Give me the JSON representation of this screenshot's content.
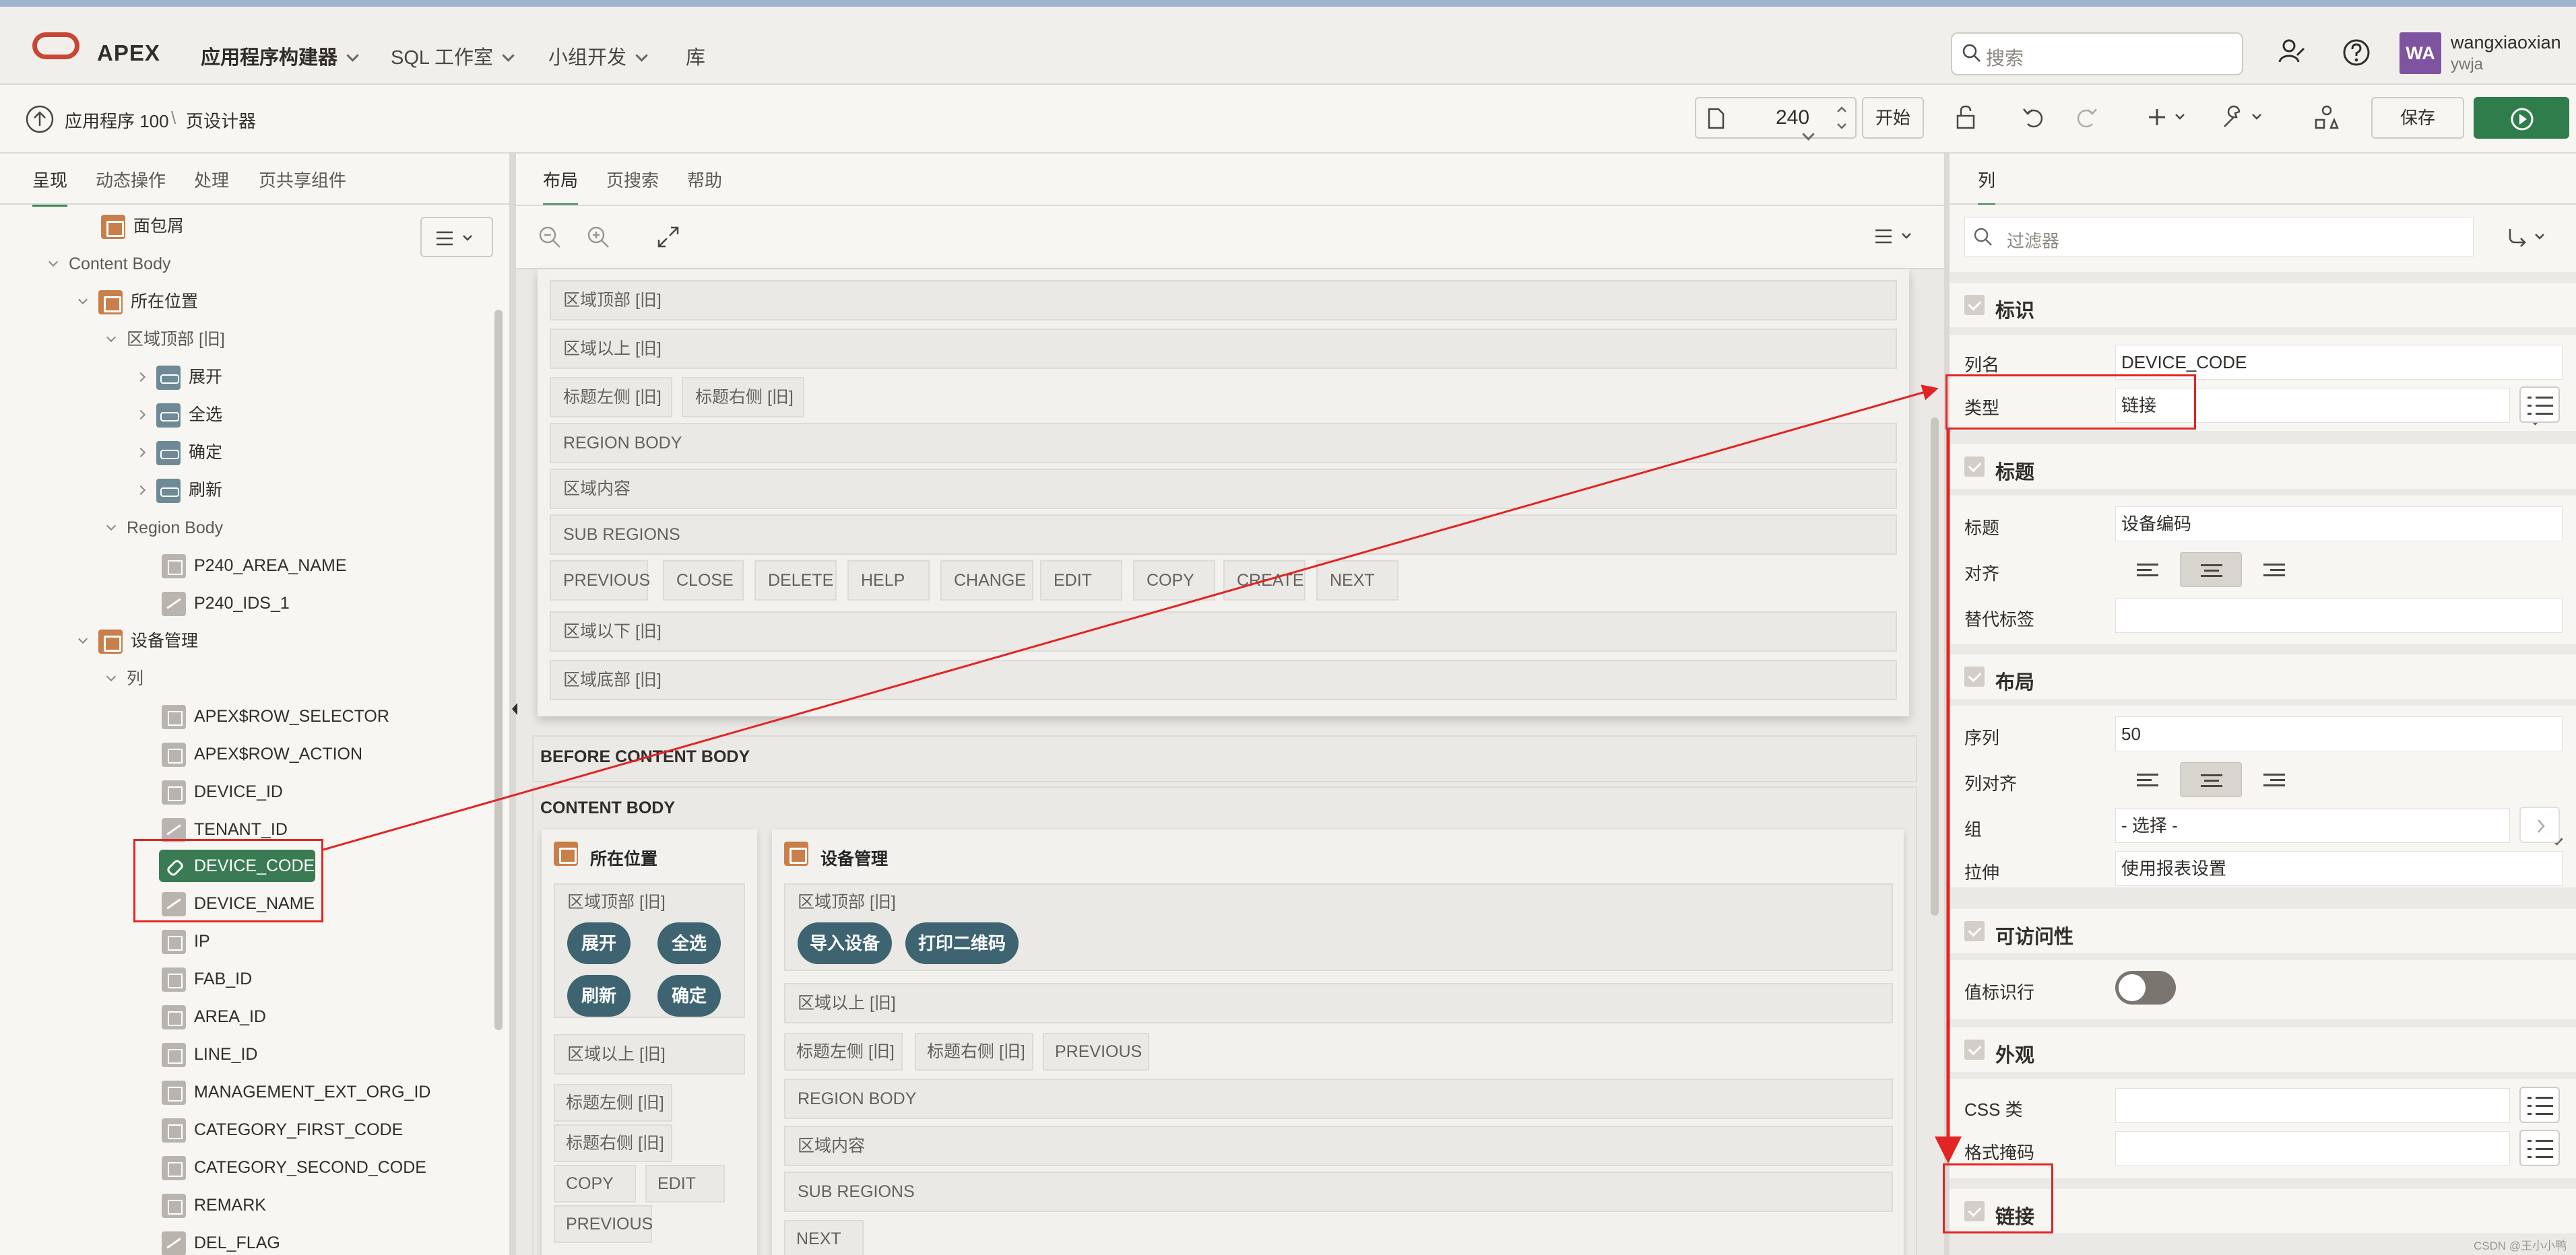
{
  "header": {
    "brand": "APEX",
    "nav": [
      "应用程序构建器",
      "SQL 工作室",
      "小组开发",
      "库"
    ],
    "search_placeholder": "搜索",
    "avatar_initials": "WA",
    "user_name": "wangxiaoxian",
    "user_workspace": "ywja"
  },
  "toolbar": {
    "breadcrumb_app": "应用程序 100",
    "breadcrumb_sep": "\\",
    "breadcrumb_page": "页设计器",
    "page_number": "240",
    "start_label": "开始",
    "save_label": "保存"
  },
  "left_panel": {
    "tabs": [
      "呈现",
      "动态操作",
      "处理",
      "页共享组件"
    ],
    "tree": [
      {
        "label": "面包屑",
        "icon": "region-icon"
      },
      {
        "label": "Content Body",
        "icon": ""
      },
      {
        "label": "所在位置",
        "icon": "region-icon"
      },
      {
        "label": "区域顶部 [旧]",
        "icon": ""
      },
      {
        "label": "展开",
        "icon": "button-icon"
      },
      {
        "label": "全选",
        "icon": "button-icon"
      },
      {
        "label": "确定",
        "icon": "button-icon"
      },
      {
        "label": "刷新",
        "icon": "button-icon"
      },
      {
        "label": "Region Body",
        "icon": ""
      },
      {
        "label": "P240_AREA_NAME",
        "icon": "text-item-icon"
      },
      {
        "label": "P240_IDS_1",
        "icon": "hidden-item-icon"
      },
      {
        "label": "设备管理",
        "icon": "report-region-icon"
      },
      {
        "label": "列",
        "icon": ""
      },
      {
        "label": "APEX$ROW_SELECTOR",
        "icon": "checkbox-column-icon"
      },
      {
        "label": "APEX$ROW_ACTION",
        "icon": "action-column-icon"
      },
      {
        "label": "DEVICE_ID",
        "icon": "column-icon"
      },
      {
        "label": "TENANT_ID",
        "icon": "hidden-column-icon"
      },
      {
        "label": "DEVICE_CODE",
        "icon": "link-column-icon"
      },
      {
        "label": "DEVICE_NAME",
        "icon": "link-column-icon"
      },
      {
        "label": "IP",
        "icon": "column-icon"
      },
      {
        "label": "FAB_ID",
        "icon": "column-icon"
      },
      {
        "label": "AREA_ID",
        "icon": "column-icon"
      },
      {
        "label": "LINE_ID",
        "icon": "column-icon"
      },
      {
        "label": "MANAGEMENT_EXT_ORG_ID",
        "icon": "column-icon"
      },
      {
        "label": "CATEGORY_FIRST_CODE",
        "icon": "column-icon"
      },
      {
        "label": "CATEGORY_SECOND_CODE",
        "icon": "column-icon"
      },
      {
        "label": "REMARK",
        "icon": "column-icon"
      },
      {
        "label": "DEL_FLAG",
        "icon": "hidden-column-icon"
      }
    ]
  },
  "center_panel": {
    "tabs": [
      "布局",
      "页搜索",
      "帮助"
    ],
    "top_region": {
      "region_top": "区域顶部 [旧]",
      "above_region": "区域以上 [旧]",
      "title_left": "标题左侧 [旧]",
      "title_right": "标题右侧 [旧]",
      "region_body": "REGION BODY",
      "region_content": "区域内容",
      "sub_regions": "SUB REGIONS",
      "buttons": [
        "PREVIOUS",
        "CLOSE",
        "DELETE",
        "HELP",
        "CHANGE",
        "EDIT",
        "COPY",
        "CREATE",
        "NEXT"
      ],
      "below_region": "区域以下 [旧]",
      "region_bottom": "区域底部 [旧]"
    },
    "before_content_body": "BEFORE CONTENT BODY",
    "content_body": "CONTENT BODY",
    "location_region": {
      "title": "所在位置",
      "region_top": "区域顶部 [旧]",
      "buttons": [
        "展开",
        "全选",
        "刷新",
        "确定"
      ],
      "above_region": "区域以上 [旧]",
      "title_left": "标题左侧 [旧]",
      "title_right": "标题右侧 [旧]",
      "chips": [
        "COPY",
        "EDIT",
        "PREVIOUS"
      ]
    },
    "device_region": {
      "title": "设备管理",
      "region_top": "区域顶部 [旧]",
      "buttons": [
        "导入设备",
        "打印二维码"
      ],
      "above_region": "区域以上 [旧]",
      "title_left": "标题左侧 [旧]",
      "title_right": "标题右侧 [旧]",
      "previous": "PREVIOUS",
      "region_body": "REGION BODY",
      "region_content": "区域内容",
      "sub_regions": "SUB REGIONS",
      "next": "NEXT"
    }
  },
  "right_panel": {
    "tab": "列",
    "filter_placeholder": "过滤器",
    "sections": {
      "identification": "标识",
      "heading": "标题",
      "layout": "布局",
      "accessibility": "可访问性",
      "appearance": "外观",
      "link": "链接"
    },
    "props": {
      "column_name_label": "列名",
      "column_name": "DEVICE_CODE",
      "type_label": "类型",
      "type": "链接",
      "heading_label": "标题",
      "heading": "设备编码",
      "alignment_label": "对齐",
      "alt_label_label": "替代标签",
      "sequence_label": "序列",
      "sequence": "50",
      "column_alignment_label": "列对齐",
      "group_label": "组",
      "group": "- 选择 -",
      "stretch_label": "拉伸",
      "stretch": "使用报表设置",
      "value_identifies_row_label": "值标识行",
      "css_classes_label": "CSS 类",
      "format_mask_label": "格式掩码"
    }
  },
  "watermark": "CSDN @王小小鸭"
}
